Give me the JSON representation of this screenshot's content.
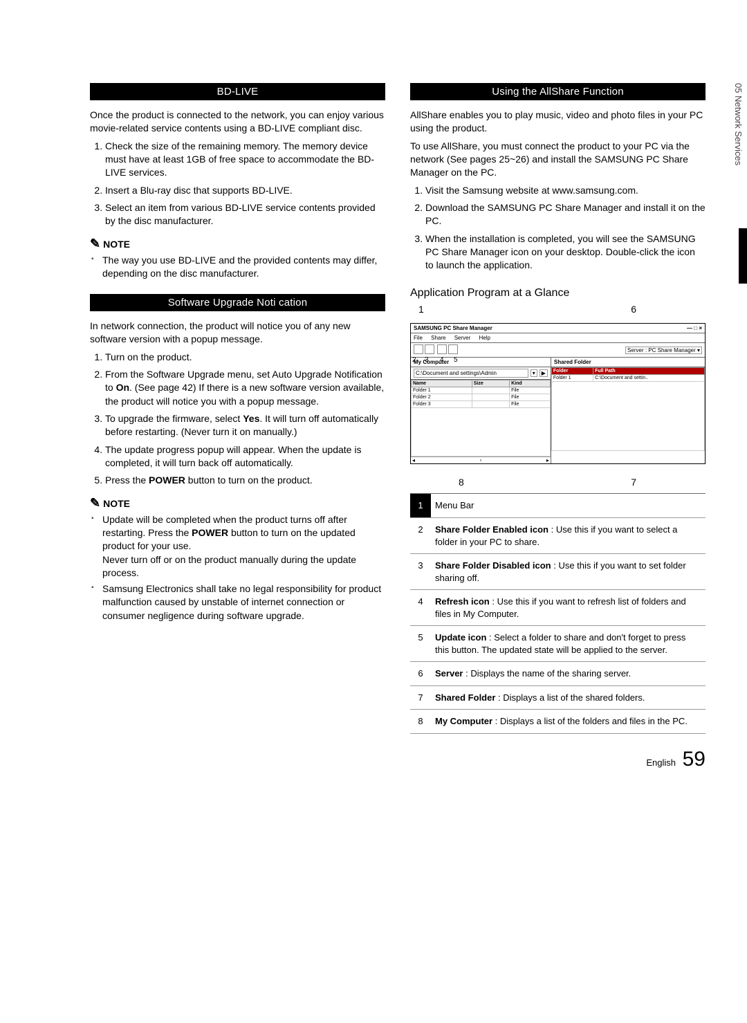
{
  "sidetab": "05  Network Services",
  "left": {
    "head1": "BD-LIVE",
    "p1": "Once the product is connected to the network, you can enjoy various movie-related service contents using a BD-LIVE compliant disc.",
    "ol1": [
      "Check the size of the remaining memory. The memory device must have at least 1GB of free space to accommodate the BD-LIVE services.",
      "Insert a Blu-ray disc that supports BD-LIVE.",
      "Select an item from various BD-LIVE service contents provided by the disc manufacturer."
    ],
    "note1_label": "NOTE",
    "note1": [
      "The way you use BD-LIVE and the provided contents may differ, depending on the disc manufacturer."
    ],
    "head2": "Software Upgrade Noti    cation",
    "p2": "In network connection, the product will notice you of any new software version with a popup message.",
    "ol2": [
      "Turn on the product.",
      "From the Software Upgrade menu, set Auto Upgrade Notification to On. (See page 42) If there is a new software version available, the product will notice you with a popup message.",
      "To upgrade the firmware, select Yes. It will turn off automatically before restarting. (Never turn it on manually.)",
      "The update progress popup will appear. When the update is completed, it will turn back off automatically.",
      "Press the POWER button to turn on the product."
    ],
    "bold_on": "On",
    "bold_yes": "Yes",
    "bold_power": "POWER",
    "note2_label": "NOTE",
    "note2": [
      "Update will be completed when the product turns off after restarting. Press the POWER button to turn on the updated product for your use. Never turn off or on the product manually during the update process.",
      "Samsung Electronics shall take no legal responsibility for product malfunction caused by unstable of internet connection or consumer negligence during software upgrade."
    ]
  },
  "right": {
    "head1": "Using the AllShare Function",
    "p1": "AllShare enables you to play music, video and photo files in your PC using the product.",
    "p2": "To use AllShare, you must connect the product to your PC via the network (See pages 25~26) and install the SAMSUNG PC Share Manager on the PC.",
    "ol1": [
      "Visit the Samsung website at www.samsung.com.",
      "Download the SAMSUNG PC Share Manager and install it on the PC.",
      "When the installation is completed, you will see the SAMSUNG PC Share Manager icon on your desktop. Double-click the icon to launch the application."
    ],
    "sub1": "Application Program at a Glance",
    "app": {
      "title": "SAMSUNG PC Share Manager",
      "win_btns": "— □ ×",
      "menus": [
        "File",
        "Share",
        "Server",
        "Help"
      ],
      "server_label": "Server : PC Share Manager  ▾",
      "left_title": "My Computer",
      "path": "C:\\Document and settings\\Admin",
      "left_headers": [
        "Name",
        "Size",
        "Kind"
      ],
      "left_rows": [
        {
          "name": "Folder 1",
          "size": "",
          "kind": "File"
        },
        {
          "name": "Folder 2",
          "size": "",
          "kind": "File"
        },
        {
          "name": "Folder 3",
          "size": "",
          "kind": "File"
        }
      ],
      "right_title": "Shared Folder",
      "right_headers": [
        "Folder",
        "Full Path"
      ],
      "right_rows": [
        {
          "folder": "Folder 1",
          "path": "C:\\Document and settin.."
        }
      ],
      "callouts": {
        "c1": "1",
        "c2": "2",
        "c3": "3",
        "c4": "4",
        "c5": "5",
        "c6": "6",
        "c7": "7",
        "c8": "8"
      }
    },
    "desc": [
      {
        "n": "1",
        "t": "Menu Bar"
      },
      {
        "n": "2",
        "b": "Share Folder Enabled icon",
        "t": " :  Use this if you want to select a folder in your PC to share."
      },
      {
        "n": "3",
        "b": "Share Folder Disabled icon",
        "t": " :  Use this if you want to set folder sharing off."
      },
      {
        "n": "4",
        "b": "Refresh icon",
        "t": " :  Use this if you want to refresh list of folders and files in My Computer."
      },
      {
        "n": "5",
        "b": "Update icon",
        "t": " : Select a folder to share and don't forget to press this button. The updated state will be applied to the server."
      },
      {
        "n": "6",
        "b": "Server",
        "t": " : Displays the name of the sharing server."
      },
      {
        "n": "7",
        "b": "Shared Folder",
        "t": " :  Displays a list of the shared folders."
      },
      {
        "n": "8",
        "b": "My Computer",
        "t": " :  Displays a list of the folders and files in the PC."
      }
    ]
  },
  "footer": {
    "lang": "English",
    "page": "59"
  }
}
